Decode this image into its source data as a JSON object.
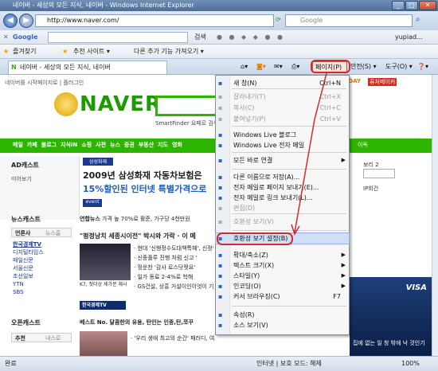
{
  "window": {
    "title": "네이버 - 세상의 모든 지식, 네이버 - Windows Internet Explorer"
  },
  "address": {
    "url": "http://www.naver.com/",
    "search_placeholder": "Google"
  },
  "google_toolbar": {
    "label": "Google",
    "search_btn": "검색",
    "user": "yupiad..."
  },
  "favorites_bar": {
    "favorites": "즐겨찾기",
    "suggested": "추천 사이트 ▾",
    "more": "다른 추가 기능 가져오기 ▾"
  },
  "tab": {
    "title": "네이버 - 세상의 모든 지식, 네이버"
  },
  "command_bar": {
    "page": "페이지(P) ▾",
    "safety": "안전(S) ▾",
    "tools": "도구(O) ▾",
    "help": "❓▾"
  },
  "menu": {
    "items": [
      {
        "label": "새 창(N)",
        "shortcut": "Ctrl+N",
        "disabled": false
      },
      {
        "label": "잘라내기(T)",
        "shortcut": "Ctrl+X",
        "disabled": true
      },
      {
        "label": "복사(C)",
        "shortcut": "Ctrl+C",
        "disabled": true
      },
      {
        "label": "붙여넣기(P)",
        "shortcut": "Ctrl+V",
        "disabled": true
      },
      {
        "label": "Windows Live 블로그",
        "shortcut": "",
        "disabled": false
      },
      {
        "label": "Windows Live 전자 메일",
        "shortcut": "",
        "disabled": false
      },
      {
        "label": "모든 바로 연결",
        "shortcut": "",
        "disabled": false,
        "submenu": true
      },
      {
        "label": "다른 이름으로 저장(A)...",
        "shortcut": "",
        "disabled": false
      },
      {
        "label": "전자 메일로 페이지 보내기(E)...",
        "shortcut": "",
        "disabled": false
      },
      {
        "label": "전자 메일로 링크 보내기(L)...",
        "shortcut": "",
        "disabled": false
      },
      {
        "label": "편집(D)",
        "shortcut": "",
        "disabled": true
      },
      {
        "label": "호환성 보기(V)",
        "shortcut": "",
        "disabled": true
      },
      {
        "label": "호환성 보기 설정(B)",
        "shortcut": "",
        "disabled": false,
        "highlighted": true
      },
      {
        "label": "확대/축소(Z)",
        "shortcut": "",
        "disabled": false,
        "submenu": true
      },
      {
        "label": "텍스트 크기(X)",
        "shortcut": "",
        "disabled": false,
        "submenu": true
      },
      {
        "label": "스타일(Y)",
        "shortcut": "",
        "disabled": false,
        "submenu": true
      },
      {
        "label": "인코딩(O)",
        "shortcut": "",
        "disabled": false,
        "submenu": true
      },
      {
        "label": "커서 브라우징(C)",
        "shortcut": "F7",
        "disabled": false
      },
      {
        "label": "속성(R)",
        "shortcut": "",
        "disabled": false
      },
      {
        "label": "소스 보기(V)",
        "shortcut": "",
        "disabled": false
      }
    ]
  },
  "page": {
    "top_links": "네이버를 시작페이지로 | 플러그인",
    "logo": "NAVER",
    "smartfinder": "SmartFinder 요페르 검색",
    "nav": [
      "메일",
      "카페",
      "블로그",
      "지식iN",
      "쇼핑",
      "사전",
      "뉴스",
      "증권",
      "부동산",
      "지도",
      "영화"
    ],
    "nav_right": "이독",
    "ad_title": "AD캐스트",
    "ad_sub": "미어보기",
    "banner_line1": "2009년 삼성화재 자동차보험은",
    "banner_line2": "15%할인된 인터넷 특별가격으로",
    "banner_brand": "삼성화재",
    "news_cast": "뉴스캐스트",
    "news_tabs": [
      "언론사",
      "뉴스홈"
    ],
    "news_sources": [
      "한국경제TV",
      "디지털타임스",
      "매일신문",
      "서울신문",
      "조선일보",
      "YTN",
      "SBS"
    ],
    "headline_cat": "연합뉴스",
    "headline_cat_text": "가격 높 70%로 활준, 가구당 4천만원",
    "headline": "\"펑정낭치 세종시이전\" 박시와 가락 · 이 메",
    "news_items": [
      "· 현대 '신행정수도대책특혜', 신정행",
      "· 신종플루 진행 처럼 신고 '",
      "· 정운찬 '감사 로스닷쩟요'",
      "· 일가 동료 2-4%로 학해",
      "· GS건설, 상흥 거설이인이엇이 기억"
    ],
    "photo_caption": "K7, 첫더상 세가문 체시",
    "press_label": "한국경제TV",
    "open_cast": "오픈캐스트",
    "open_tabs": [
      "추천",
      "내스로"
    ],
    "open_headline": "베스트 No. 달콤한의 유용, 탄인는 인종,탄,쪼꾸",
    "open_item": "· '우리 생애 최고의 순간' 패러디, 여자 주연의 요리기...",
    "right_ad_caption": "집에 없는 일 청 밖에 낙 것인기",
    "right_ad_brand": "VISA",
    "right_labels": [
      "보리 2",
      "IP회건"
    ]
  },
  "status_bar": {
    "left": "완료",
    "zone": "인터넷 | 보호 모드: 해제",
    "zoom": "100%"
  }
}
